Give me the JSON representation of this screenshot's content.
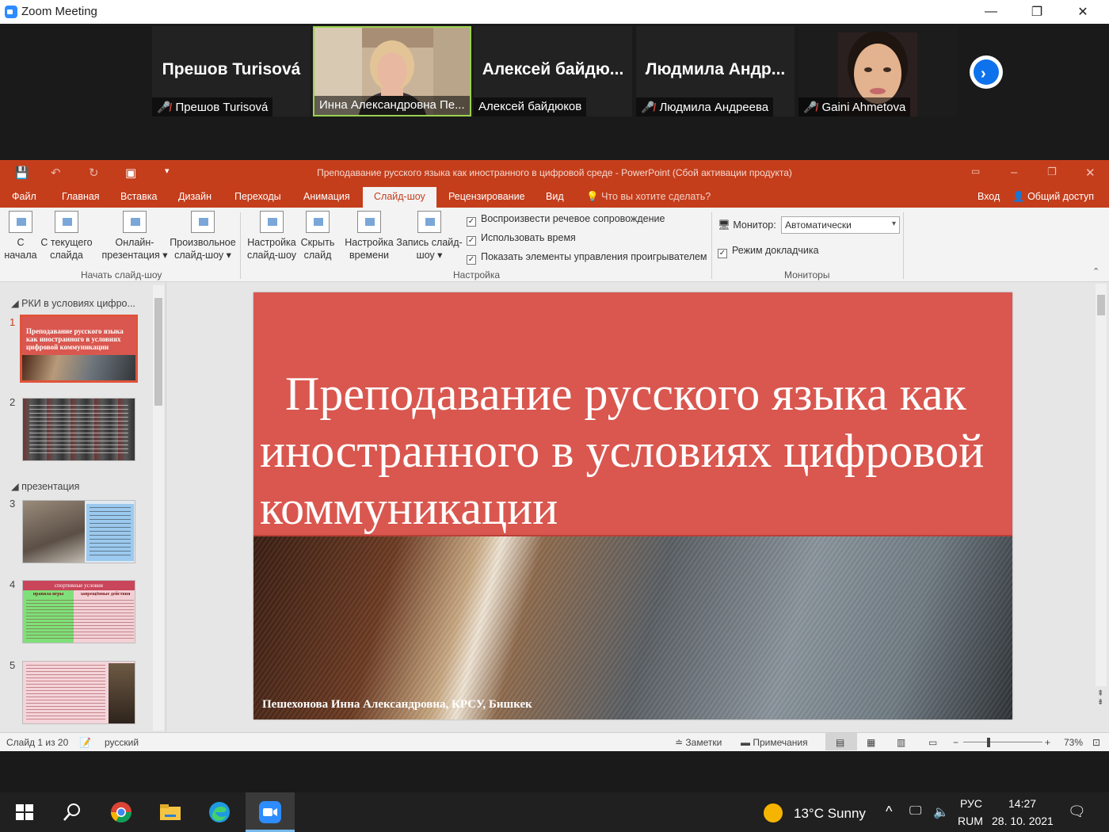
{
  "zoom": {
    "window_title": "Zoom Meeting",
    "controls": {
      "minimize": "—",
      "maximize": "❐",
      "close": "✕"
    },
    "participants": [
      {
        "big_name": "Прешов Turisová",
        "label": "Прешов Turisová",
        "muted": true,
        "video": false
      },
      {
        "big_name": "",
        "label": "Инна Александровна Пе...",
        "muted": false,
        "video": true,
        "active": true
      },
      {
        "big_name": "Алексей байдю...",
        "label": "Алексей байдюков",
        "muted": false,
        "video": false
      },
      {
        "big_name": "Людмила Андр...",
        "label": "Людмила Андреева",
        "muted": true,
        "video": false
      },
      {
        "big_name": "",
        "label": "Gaini Ahmetova",
        "muted": true,
        "video": true
      }
    ],
    "next_page_glyph": "›"
  },
  "powerpoint": {
    "doc_title": "Преподавание русского языка как иностранного в цифровой среде - PowerPoint (Сбой активации продукта)",
    "tabs": [
      "Файл",
      "Главная",
      "Вставка",
      "Дизайн",
      "Переходы",
      "Анимация",
      "Слайд-шоу",
      "Рецензирование",
      "Вид"
    ],
    "selected_tab": "Слайд-шоу",
    "tell_me": "Что вы хотите сделать?",
    "sign_in": "Вход",
    "share": "Общий доступ",
    "ribbon": {
      "start_group": {
        "label": "Начать слайд-шоу",
        "buttons": [
          {
            "line1": "С",
            "line2": "начала"
          },
          {
            "line1": "С текущего",
            "line2": "слайда"
          },
          {
            "line1": "Онлайн-",
            "line2": "презентация ▾"
          },
          {
            "line1": "Произвольное",
            "line2": "слайд-шоу ▾"
          }
        ]
      },
      "setup_group": {
        "label": "Настройка",
        "buttons": [
          {
            "line1": "Настройка",
            "line2": "слайд-шоу"
          },
          {
            "line1": "Скрыть",
            "line2": "слайд"
          },
          {
            "line1": "Настройка",
            "line2": "времени"
          },
          {
            "line1": "Запись слайд-",
            "line2": "шоу ▾"
          }
        ],
        "checkboxes": [
          "Воспроизвести речевое сопровождение",
          "Использовать время",
          "Показать элементы управления проигрывателем"
        ]
      },
      "monitors_group": {
        "label": "Мониторы",
        "monitor_label": "Монитор:",
        "monitor_value": "Автоматически",
        "presenter_view": "Режим докладчика"
      }
    },
    "thumbnail_pane": {
      "sections": [
        "РКИ в условиях цифро...",
        "презентация"
      ],
      "slide_numbers": [
        "1",
        "2",
        "3",
        "4",
        "5"
      ],
      "thumb1_text": "Преподавание русского языка как иностранного в условиях цифровой коммуникации",
      "thumb4_header": "спортивные условия",
      "thumb4_col1": "правила игры",
      "thumb4_col2": "запрещённые действия"
    },
    "slide": {
      "title": "Преподавание русского языка как иностранного в условиях цифровой коммуникации",
      "author": "Пешехонова Инна Александровна, КРСУ, Бишкек",
      "band_color": "#d9574f"
    },
    "status_bar": {
      "slide_counter": "Слайд 1 из 20",
      "language": "русский",
      "notes": "Заметки",
      "comments": "Примечания",
      "zoom": "73%"
    }
  },
  "taskbar": {
    "weather": "13°C  Sunny",
    "lang_line1": "РУС",
    "lang_line2": "RUM",
    "time": "14:27",
    "date": "28. 10. 2021"
  }
}
